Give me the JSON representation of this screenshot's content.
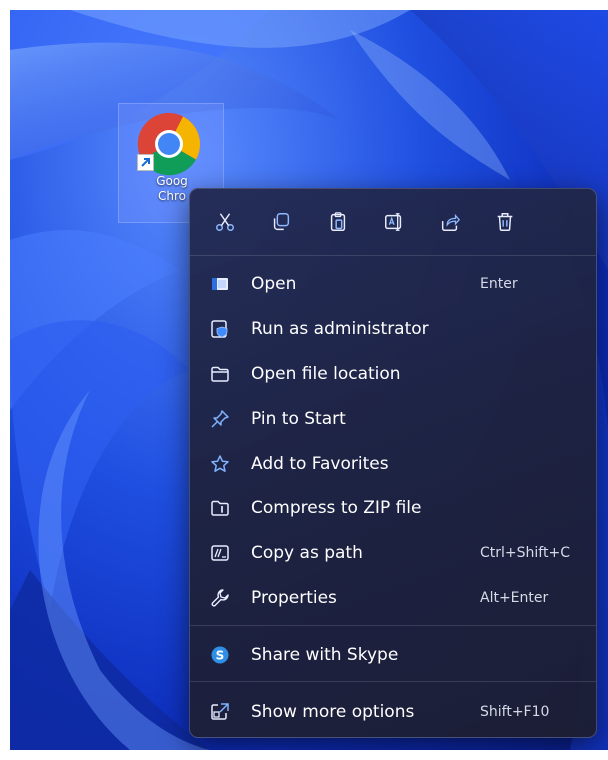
{
  "desktop_icon": {
    "label": "Goog\nChro",
    "icon": "chrome-icon",
    "shortcut_overlay": "shortcut-arrow-icon"
  },
  "quick_actions": [
    {
      "name": "cut",
      "icon": "scissors-icon"
    },
    {
      "name": "copy",
      "icon": "copy-icon"
    },
    {
      "name": "paste",
      "icon": "paste-icon"
    },
    {
      "name": "rename",
      "icon": "rename-icon"
    },
    {
      "name": "share",
      "icon": "share-icon"
    },
    {
      "name": "delete",
      "icon": "trash-icon"
    }
  ],
  "menu": {
    "items": [
      {
        "label": "Open",
        "shortcut": "Enter",
        "icon": "open-window-icon"
      },
      {
        "label": "Run as administrator",
        "shortcut": "",
        "icon": "shield-icon"
      },
      {
        "label": "Open file location",
        "shortcut": "",
        "icon": "folder-icon"
      },
      {
        "label": "Pin to Start",
        "shortcut": "",
        "icon": "pin-icon"
      },
      {
        "label": "Add to Favorites",
        "shortcut": "",
        "icon": "star-icon"
      },
      {
        "label": "Compress to ZIP file",
        "shortcut": "",
        "icon": "zip-folder-icon"
      },
      {
        "label": "Copy as path",
        "shortcut": "Ctrl+Shift+C",
        "icon": "copy-path-icon"
      },
      {
        "label": "Properties",
        "shortcut": "Alt+Enter",
        "icon": "wrench-icon"
      },
      {
        "label": "Share with Skype",
        "shortcut": "",
        "icon": "skype-icon"
      },
      {
        "label": "Show more options",
        "shortcut": "Shift+F10",
        "icon": "more-options-icon"
      }
    ]
  },
  "colors": {
    "menu_background": "#232848",
    "icon_accent": "#7fb3ff",
    "skype_blue": "#2f8fe6",
    "wallpaper_blue": "#1f4fe0"
  }
}
